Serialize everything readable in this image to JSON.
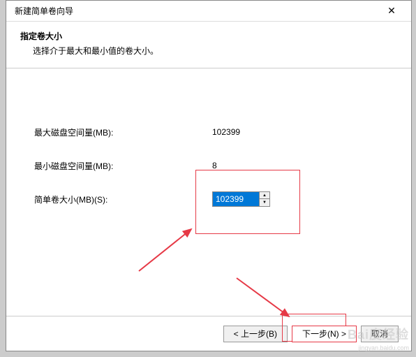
{
  "dialog": {
    "title": "新建简单卷向导",
    "close": "✕"
  },
  "header": {
    "title": "指定卷大小",
    "description": "选择介于最大和最小值的卷大小。"
  },
  "fields": {
    "maxDiskLabel": "最大磁盘空间量(MB):",
    "maxDiskValue": "102399",
    "minDiskLabel": "最小磁盘空间量(MB):",
    "minDiskValue": "8",
    "volumeSizeLabel": "简单卷大小(MB)(S):",
    "volumeSizeValue": "102399"
  },
  "buttons": {
    "back": "< 上一步(B)",
    "next": "下一步(N) >",
    "cancel": "取消"
  },
  "spinner": {
    "up": "▲",
    "down": "▼"
  },
  "watermark": {
    "main": "Bai度经验",
    "sub": "jingyan.baidu.com"
  }
}
